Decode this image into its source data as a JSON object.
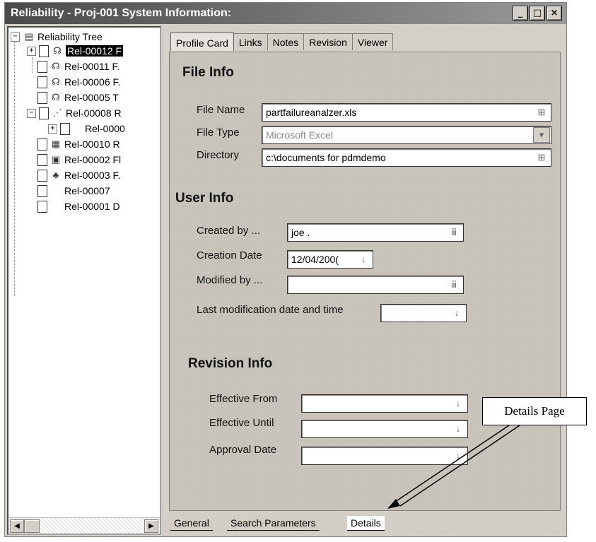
{
  "window": {
    "title": "Reliability - Proj-001 System Information:",
    "minimize": "_",
    "maximize": "□",
    "close": "×"
  },
  "tree": {
    "root_label": "Reliability Tree",
    "items": [
      {
        "label": "Rel-00012 F",
        "selected": true
      },
      {
        "label": "Rel-00011 F."
      },
      {
        "label": "Rel-00006 F."
      },
      {
        "label": "Rel-00005 T"
      },
      {
        "label": "Rel-00008 R"
      },
      {
        "label": "Rel-0000"
      },
      {
        "label": "Rel-00010 R"
      },
      {
        "label": "Rel-00002 Fl"
      },
      {
        "label": "Rel-00003 F."
      },
      {
        "label": "Rel-00007"
      },
      {
        "label": "Rel-00001 D"
      }
    ]
  },
  "tabs": [
    "Profile Card",
    "Links",
    "Notes",
    "Revision",
    "Viewer"
  ],
  "file_info": {
    "heading": "File Info",
    "file_name_label": "File Name",
    "file_name_value": "partfailureanalzer.xls",
    "file_type_label": "File Type",
    "file_type_value": "Microsoft Excel",
    "directory_label": "Directory",
    "directory_value": "c:\\documents for pdmdemo"
  },
  "user_info": {
    "heading": "User Info",
    "created_by_label": "Created by ...",
    "created_by_value": "joe .",
    "creation_date_label": "Creation Date",
    "creation_date_value": "12/04/200(",
    "modified_by_label": "Modified by ...",
    "modified_by_value": "",
    "last_mod_label": "Last modification date and time",
    "last_mod_value": ""
  },
  "revision_info": {
    "heading": "Revision Info",
    "effective_from_label": "Effective From",
    "effective_until_label": "Effective Until",
    "approval_date_label": "Approval Date"
  },
  "bottom_tabs": [
    "General",
    "Search Parameters",
    "Details"
  ],
  "callout": "Details Page"
}
